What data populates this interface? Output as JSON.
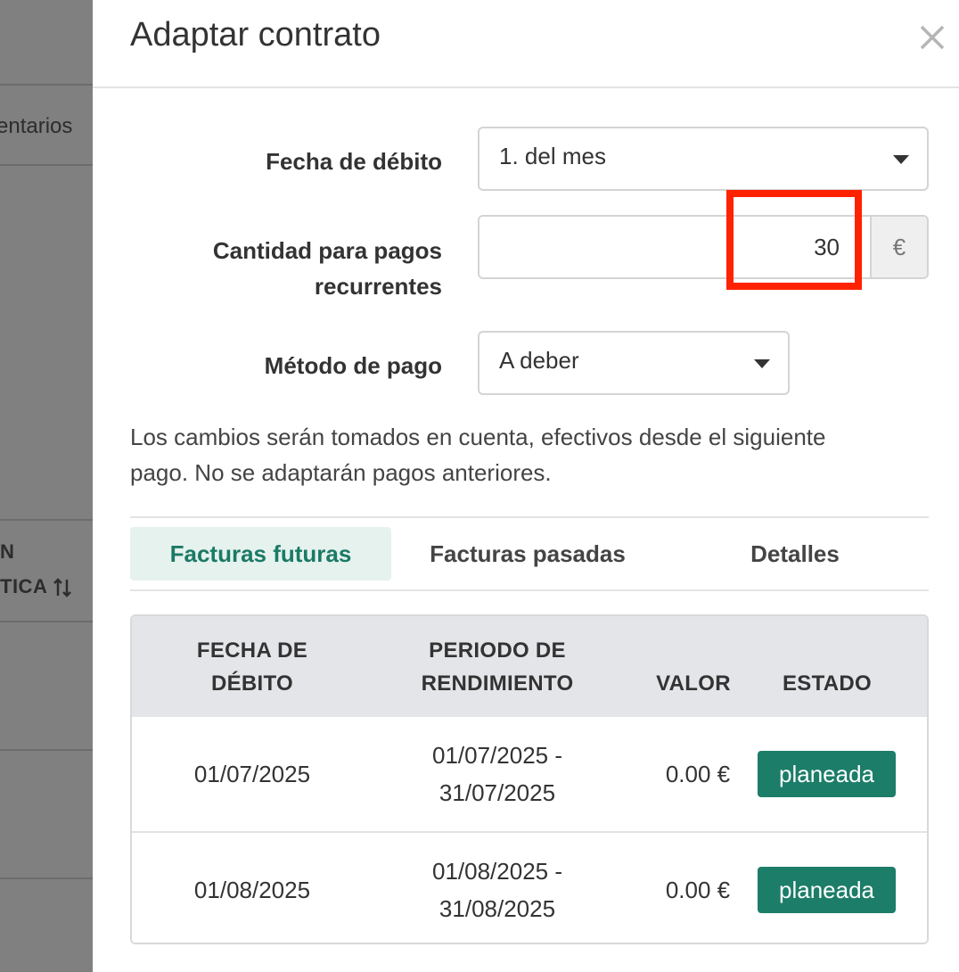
{
  "background": {
    "header_fragment": "entarios",
    "column_fragment_1": "N",
    "column_fragment_2": "TICA"
  },
  "modal": {
    "title": "Adaptar contrato",
    "close_icon": "close-icon"
  },
  "form": {
    "debit_date": {
      "label": "Fecha de débito",
      "value": "1. del mes"
    },
    "recurring_amount": {
      "label_line1": "Cantidad para pagos",
      "label_line2": "recurrentes",
      "value": "30",
      "currency": "€"
    },
    "payment_method": {
      "label": "Método de pago",
      "value": "A deber"
    }
  },
  "info": {
    "line1": "Los cambios serán tomados en cuenta, efectivos desde el siguiente",
    "line2": "pago. No se adaptarán pagos anteriores."
  },
  "tabs": [
    {
      "label": "Facturas futuras",
      "active": true
    },
    {
      "label": "Facturas pasadas",
      "active": false
    },
    {
      "label": "Detalles",
      "active": false
    }
  ],
  "table": {
    "headers": {
      "debit_date_1": "FECHA DE",
      "debit_date_2": "DÉBITO",
      "period_1": "PERIODO DE",
      "period_2": "RENDIMIENTO",
      "value": "VALOR",
      "status": "ESTADO"
    },
    "rows": [
      {
        "debit_date": "01/07/2025",
        "period_start": "01/07/2025 -",
        "period_end": "31/07/2025",
        "value": "0.00 €",
        "status": "planeada"
      },
      {
        "debit_date": "01/08/2025",
        "period_start": "01/08/2025 -",
        "period_end": "31/08/2025",
        "value": "0.00 €",
        "status": "planeada"
      }
    ]
  },
  "colors": {
    "accent": "#1c7d68",
    "active_tab_bg": "#e6f2ee",
    "highlight": "#ff2200"
  }
}
